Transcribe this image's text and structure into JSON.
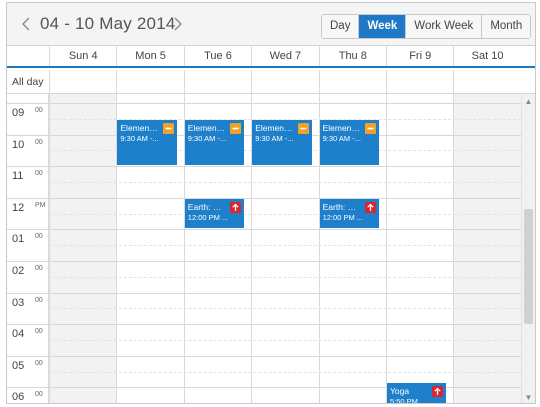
{
  "header": {
    "date_range": "04 - 10 May 2014",
    "views": [
      "Day",
      "Week",
      "Work Week",
      "Month"
    ],
    "active_view": "Week"
  },
  "days": [
    "Sun 4",
    "Mon 5",
    "Tue 6",
    "Wed 7",
    "Thu 8",
    "Fri 9",
    "Sat 10"
  ],
  "all_day_label": "All day",
  "time_rows": [
    {
      "hour": "09",
      "suffix": "00"
    },
    {
      "hour": "10",
      "suffix": "00"
    },
    {
      "hour": "11",
      "suffix": "00"
    },
    {
      "hour": "12",
      "suffix": "PM"
    },
    {
      "hour": "01",
      "suffix": "00"
    },
    {
      "hour": "02",
      "suffix": "00"
    },
    {
      "hour": "03",
      "suffix": "00"
    },
    {
      "hour": "04",
      "suffix": "00"
    },
    {
      "hour": "05",
      "suffix": "00"
    },
    {
      "hour": "06",
      "suffix": "00"
    }
  ],
  "appointments": [
    {
      "day": 1,
      "start": 9.5,
      "end": 11.0,
      "subject": "Elementa...",
      "time": "9:30 AM -...",
      "priority": "medium"
    },
    {
      "day": 2,
      "start": 9.5,
      "end": 11.0,
      "subject": "Elementa...",
      "time": "9:30 AM -...",
      "priority": "medium"
    },
    {
      "day": 3,
      "start": 9.5,
      "end": 11.0,
      "subject": "Elementa...",
      "time": "9:30 AM -...",
      "priority": "medium"
    },
    {
      "day": 4,
      "start": 9.5,
      "end": 11.0,
      "subject": "Elementa...",
      "time": "9:30 AM -...",
      "priority": "medium"
    },
    {
      "day": 2,
      "start": 12.0,
      "end": 13.0,
      "subject": "Earth: Ou...",
      "time": "12:00 PM ...",
      "priority": "high"
    },
    {
      "day": 4,
      "start": 12.0,
      "end": 13.0,
      "subject": "Earth: Ou...",
      "time": "12:00 PM ...",
      "priority": "high"
    },
    {
      "day": 5,
      "start": 17.83,
      "end": 19.0,
      "subject": "Yoga",
      "time": "5:50 PM ...",
      "priority": "high"
    }
  ],
  "colors": {
    "accent": "#1e77c7",
    "appointment": "#1e7fcb",
    "priority_medium": "#f1a12a",
    "priority_high": "#d9262e",
    "weekend": "#f2f2f2"
  },
  "icons": {
    "prev": "chevron-left-icon",
    "next": "chevron-right-icon",
    "medium": "minus-icon",
    "high": "arrow-up-icon"
  }
}
